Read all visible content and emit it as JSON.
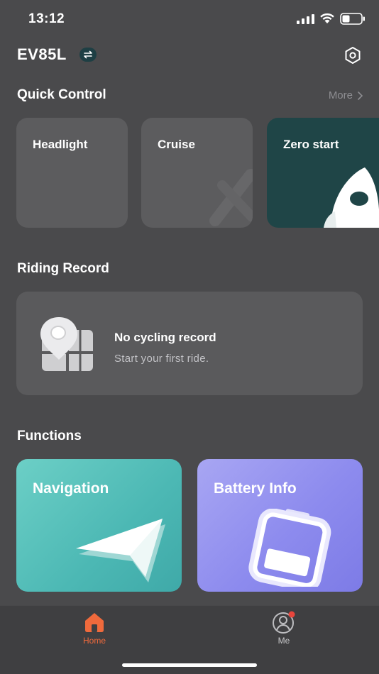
{
  "status_bar": {
    "time": "13:12",
    "icons": [
      "signal-icon",
      "wifi-icon",
      "battery-icon"
    ]
  },
  "header": {
    "device_name": "EV85L",
    "switch_icon": "swap-icon",
    "settings_icon": "hexagon-settings-icon"
  },
  "quick_control": {
    "title": "Quick Control",
    "more_label": "More",
    "items": [
      {
        "label": "Headlight",
        "active": false
      },
      {
        "label": "Cruise",
        "active": false
      },
      {
        "label": "Zero start",
        "active": true,
        "icon": "rocket-icon"
      }
    ]
  },
  "riding_record": {
    "title": "Riding Record",
    "empty_title": "No cycling record",
    "empty_subtitle": "Start your first ride.",
    "icon": "map-pin-icon"
  },
  "functions": {
    "title": "Functions",
    "items": [
      {
        "label": "Navigation",
        "icon": "navigation-arrow-icon"
      },
      {
        "label": "Battery Info",
        "icon": "battery-icon"
      }
    ]
  },
  "tab_bar": {
    "tabs": [
      {
        "label": "Home",
        "icon": "home-icon",
        "selected": true
      },
      {
        "label": "Me",
        "icon": "user-icon",
        "selected": false,
        "badge": true
      }
    ]
  },
  "colors": {
    "background": "#4a4a4c",
    "card": "#5c5c5e",
    "active_card": "#1f4547",
    "accent": "#f06a3c",
    "navigation_card": "#4cb8b4",
    "battery_card": "#8d8bee",
    "badge": "#e8453c"
  }
}
